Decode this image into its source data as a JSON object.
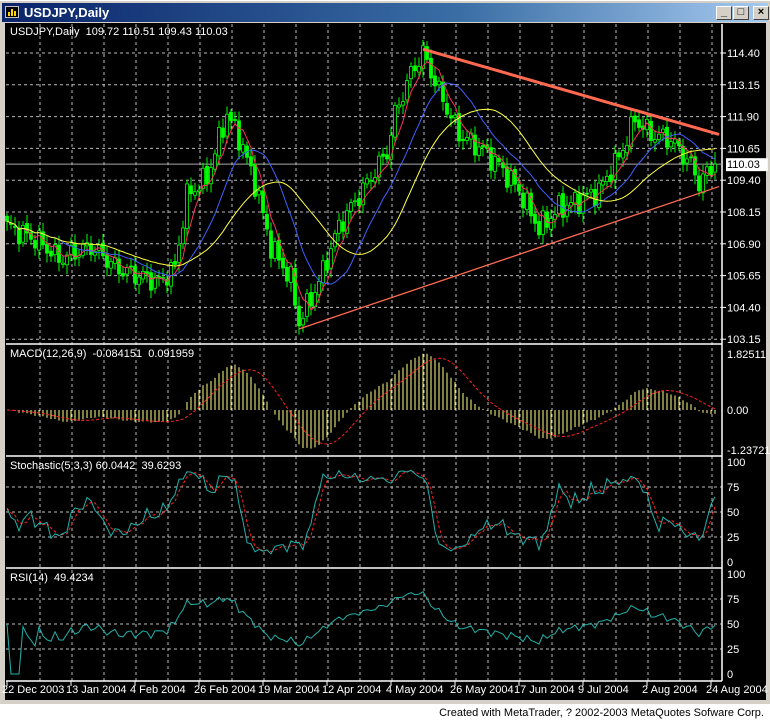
{
  "window": {
    "title": "USDJPY,Daily",
    "buttons": {
      "minimize": "_",
      "maximize": "□",
      "close": "×"
    }
  },
  "footer": "Created with MetaTrader, ? 2002-2003 MetaQuotes Sofware Corp.",
  "chart_data": {
    "type": "candlestick",
    "title": "USDJPY,Daily",
    "header": {
      "symbol": "USDJPY,Daily",
      "open": "109.72",
      "high": "110.51",
      "low": "109.43",
      "close": "110.03"
    },
    "current_price": "110.03",
    "price_axis": [
      "114.40",
      "113.15",
      "111.90",
      "110.65",
      "109.40",
      "108.15",
      "106.90",
      "105.65",
      "104.40",
      "103.15"
    ],
    "ylim": [
      103.15,
      114.4
    ],
    "bars": 178,
    "close_keypoints": [
      [
        0,
        107.6
      ],
      [
        8,
        107.0
      ],
      [
        13,
        106.3
      ],
      [
        21,
        106.8
      ],
      [
        28,
        105.9
      ],
      [
        38,
        105.4
      ],
      [
        42,
        106.0
      ],
      [
        45,
        108.8
      ],
      [
        50,
        109.5
      ],
      [
        55,
        112.0
      ],
      [
        58,
        111.1
      ],
      [
        62,
        109.3
      ],
      [
        66,
        106.8
      ],
      [
        71,
        105.5
      ],
      [
        73,
        103.8
      ],
      [
        78,
        105.4
      ],
      [
        83,
        107.6
      ],
      [
        88,
        108.8
      ],
      [
        95,
        110.5
      ],
      [
        97,
        112.0
      ],
      [
        101,
        113.6
      ],
      [
        104,
        114.4
      ],
      [
        108,
        112.9
      ],
      [
        113,
        111.2
      ],
      [
        118,
        110.7
      ],
      [
        123,
        110.0
      ],
      [
        128,
        109.0
      ],
      [
        133,
        107.5
      ],
      [
        138,
        108.3
      ],
      [
        143,
        108.6
      ],
      [
        148,
        109.0
      ],
      [
        153,
        110.3
      ],
      [
        157,
        111.8
      ],
      [
        161,
        111.2
      ],
      [
        166,
        111.0
      ],
      [
        171,
        110.0
      ],
      [
        173,
        109.3
      ],
      [
        177,
        110.03
      ]
    ],
    "last_bar": {
      "open": 109.72,
      "high": 110.51,
      "low": 109.43,
      "close": 110.03
    },
    "moving_averages": [
      {
        "period": 5,
        "color": "#ff3060"
      },
      {
        "period": 14,
        "color": "#4060ff"
      },
      {
        "period": 26,
        "color": "#ffff40"
      }
    ],
    "trendlines": [
      {
        "name": "resistance",
        "from": [
          104,
          114.55
        ],
        "to": [
          178,
          111.2
        ],
        "color": "#ff6a50"
      },
      {
        "name": "support",
        "from": [
          73,
          103.55
        ],
        "to": [
          178,
          109.15
        ],
        "color": "#ff6a50"
      }
    ],
    "date_axis": [
      {
        "bar": 0,
        "label": "22 Dec 2003"
      },
      {
        "bar": 16,
        "label": "13 Jan 2004"
      },
      {
        "bar": 32,
        "label": "4 Feb 2004"
      },
      {
        "bar": 48,
        "label": "26 Feb 2004"
      },
      {
        "bar": 64,
        "label": "19 Mar 2004"
      },
      {
        "bar": 80,
        "label": "12 Apr 2004"
      },
      {
        "bar": 96,
        "label": "4 May 2004"
      },
      {
        "bar": 112,
        "label": "26 May 2004"
      },
      {
        "bar": 128,
        "label": "17 Jun 2004"
      },
      {
        "bar": 144,
        "label": "9 Jul 2004"
      },
      {
        "bar": 160,
        "label": "2 Aug 2004"
      },
      {
        "bar": 176,
        "label": "24 Aug 2004"
      }
    ],
    "indicators": {
      "macd": {
        "label": "MACD(12,26,9)",
        "value1": "-0.084151",
        "value2": "0.091959",
        "fast": 12,
        "slow": 26,
        "signal": 9,
        "axis": [
          "1.82511",
          "0.00",
          "-1.23721"
        ],
        "ylim": [
          -1.23721,
          1.82511
        ],
        "hist_color": "#ffff80",
        "signal_color": "#ff2020"
      },
      "stochastic": {
        "label": "Stochastic(5,3,3)",
        "value1": "60.0442",
        "value2": "39.6293",
        "k": 5,
        "d": 3,
        "slowing": 3,
        "axis": [
          "100",
          "75",
          "50",
          "25",
          "0"
        ],
        "ylim": [
          0,
          100
        ],
        "main_color": "#20b2aa",
        "signal_color": "#ff2020"
      },
      "rsi": {
        "label": "RSI(14)",
        "value1": "49.4234",
        "period": 14,
        "axis": [
          "100",
          "75",
          "50",
          "25",
          "0"
        ],
        "ylim": [
          0,
          100
        ],
        "color": "#20b2aa"
      }
    },
    "colors": {
      "background": "#000000",
      "grid": "#c0c0c0",
      "candle": "#00ff00",
      "text": "#ffffff"
    }
  }
}
